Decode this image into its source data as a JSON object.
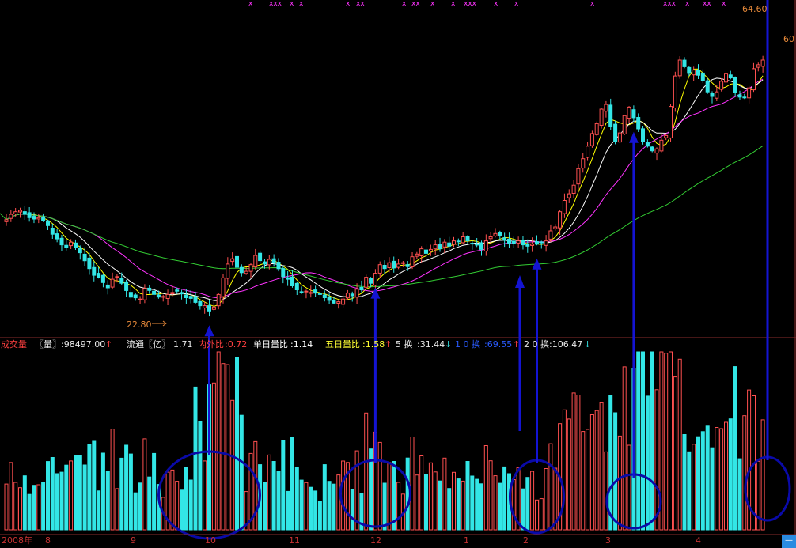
{
  "chart_data": {
    "type": "candlestick",
    "price_labels": {
      "high": "64.60",
      "low": "22.80",
      "right_edge": "60"
    },
    "price_range": [
      22.8,
      64.6
    ],
    "volume_panel": {
      "title": "成交量",
      "volume_label": "〖量〗",
      "volume_value": ":98497.00",
      "float_label": "流通〖亿〗",
      "float_value": "1.71",
      "inner_outer_label": "内外比",
      "inner_outer_value": ":0.72",
      "single_ratio_label": "单日量比",
      "single_ratio_value": ":1.14",
      "five_ratio_label": "五日量比",
      "five_ratio_value": ":1.58",
      "five_turn_label": "5 换",
      "five_turn_value": ":31.44",
      "ten_turn_label": "1 0 换",
      "ten_turn_value": ":69.55",
      "twenty_turn_label": "2 0 换",
      "twenty_turn_value": ":106.47"
    },
    "x_axis": {
      "year_label": "2008年",
      "months": [
        "8",
        "9",
        "10",
        "11",
        "12",
        "1",
        "2",
        "3",
        "4"
      ]
    },
    "close": [
      36.6,
      37.4,
      37.8,
      38.0,
      37.4,
      36.9,
      36.7,
      36.9,
      36.4,
      35.7,
      34.4,
      33.7,
      32.8,
      32.4,
      33.2,
      32.4,
      31.6,
      30.4,
      29.2,
      28.2,
      27.9,
      27.1,
      26.3,
      27.6,
      28.0,
      27.0,
      25.9,
      24.9,
      24.8,
      24.6,
      26.2,
      25.9,
      25.3,
      24.9,
      25.0,
      25.3,
      25.6,
      25.8,
      25.4,
      24.8,
      24.7,
      24.1,
      23.6,
      23.6,
      22.8,
      23.4,
      25.3,
      27.8,
      29.9,
      30.7,
      29.4,
      28.6,
      28.8,
      29.8,
      31.2,
      30.4,
      29.9,
      30.6,
      30.1,
      29.2,
      28.0,
      27.6,
      26.6,
      26.0,
      25.6,
      25.8,
      25.6,
      25.5,
      25.3,
      24.8,
      24.4,
      24.0,
      24.2,
      24.6,
      25.5,
      25.1,
      26.1,
      26.0,
      27.9,
      27.0,
      28.5,
      29.8,
      29.2,
      30.1,
      29.3,
      29.9,
      30.1,
      29.5,
      31.0,
      31.4,
      32.2,
      31.5,
      32.1,
      32.8,
      32.2,
      33.2,
      32.6,
      33.4,
      33.3,
      34.0,
      33.4,
      33.0,
      32.8,
      32.1,
      33.4,
      34.0,
      34.5,
      34.2,
      33.5,
      33.0,
      33.0,
      33.4,
      32.8,
      32.6,
      32.9,
      32.9,
      33.1,
      33.4,
      34.9,
      35.5,
      37.8,
      39.5,
      40.5,
      41.8,
      44.3,
      45.8,
      47.7,
      49.6,
      51.1,
      53.3,
      54.0,
      50.7,
      48.4,
      49.7,
      52.3,
      53.6,
      52.0,
      50.3,
      48.4,
      47.7,
      47.0,
      47.3,
      48.6,
      49.3,
      53.7,
      58.3,
      60.7,
      59.7,
      58.8,
      59.2,
      58.4,
      57.6,
      55.9,
      55.2,
      55.9,
      57.5,
      58.7,
      58.0,
      55.8,
      55.1,
      55.1,
      56.5,
      59.4,
      60.0,
      60.7
    ],
    "ma_series": [
      {
        "name": "",
        "color": "#ffff00"
      },
      {
        "name": "",
        "color": "#ffffff"
      },
      {
        "name": "",
        "color": "#ff33ff"
      },
      {
        "name": "",
        "color": "#33cc33"
      }
    ],
    "annotation_colors": {
      "circles": "#0a0aa8",
      "arrows": "#1414d2",
      "up_candle": "#ff5050",
      "down_candle": "#33e6e6",
      "price_label": "#e88a3a"
    },
    "annotated_arrow_indices": [
      44,
      80,
      115,
      136,
      165
    ]
  }
}
